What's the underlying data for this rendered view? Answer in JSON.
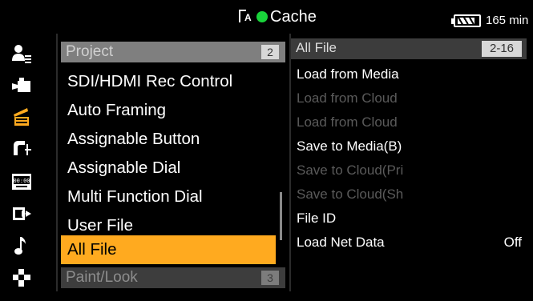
{
  "status_bar": {
    "media_icon_letter": "A",
    "cache_label": "Cache",
    "battery_label": "165 min",
    "cache_status_color": "#19d33a",
    "battery_level": 0.8
  },
  "sidebar": {
    "icons": [
      {
        "name": "user-menu-icon"
      },
      {
        "name": "camera-icon"
      },
      {
        "name": "clapperboard-icon"
      },
      {
        "name": "tc-icon"
      },
      {
        "name": "timecode-icon"
      },
      {
        "name": "output-icon"
      },
      {
        "name": "audio-icon"
      },
      {
        "name": "paint-look-icon"
      }
    ]
  },
  "menu": {
    "header": {
      "label": "Project",
      "number": "2"
    },
    "items": [
      {
        "label": "SDI/HDMI Rec Control"
      },
      {
        "label": "Auto Framing"
      },
      {
        "label": "Assignable Button"
      },
      {
        "label": "Assignable Dial"
      },
      {
        "label": "Multi Function Dial"
      },
      {
        "label": "User File"
      },
      {
        "label": "All File",
        "selected": true
      }
    ],
    "footer": {
      "label": "Paint/Look",
      "number": "3"
    },
    "accent_color": "#ffaa1f"
  },
  "sub_menu": {
    "header": {
      "label": "All File",
      "range": "2-16"
    },
    "items": [
      {
        "label": "Load from Media",
        "enabled": true
      },
      {
        "label": "Load from Cloud",
        "enabled": false
      },
      {
        "label": "Load from Cloud",
        "enabled": false
      },
      {
        "label": "Save to Media(B)",
        "enabled": true
      },
      {
        "label": "Save to Cloud(Pri",
        "enabled": false
      },
      {
        "label": "Save to Cloud(Sh",
        "enabled": false
      },
      {
        "label": "File ID",
        "enabled": true
      },
      {
        "label": "Load Net Data",
        "enabled": true,
        "value": "Off"
      }
    ]
  }
}
